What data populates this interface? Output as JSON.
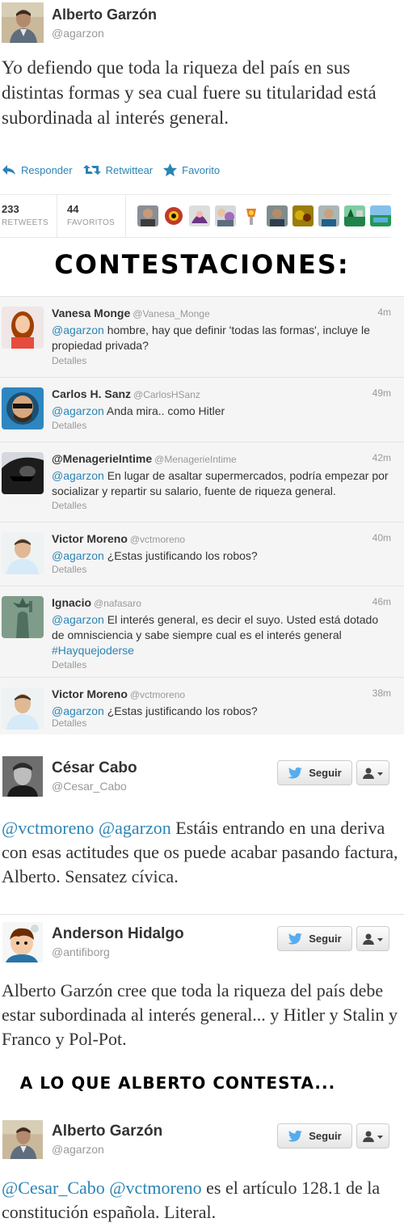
{
  "main_tweet": {
    "name": "Alberto Garzón",
    "handle": "@agarzon",
    "text": "Yo defiendo que toda la riqueza del país en sus distintas formas y sea cual fuere su titularidad está subordinada al interés general.",
    "actions": {
      "reply": "Responder",
      "retweet": "Retwittear",
      "favorite": "Favorito"
    },
    "stats": {
      "retweets_count": "233",
      "retweets_label": "RETWEETS",
      "favorites_count": "44",
      "favorites_label": "FAVORITOS"
    }
  },
  "banner_replies": "CONTESTACIONES:",
  "replies": [
    {
      "name": "Vanesa Monge",
      "handle": "@Vanesa_Monge",
      "time": "4m",
      "mention": "@agarzon",
      "text": " hombre, hay que definir 'todas las formas', incluye le propiedad privada?",
      "hashtag": "",
      "details": "Detalles"
    },
    {
      "name": "Carlos H. Sanz",
      "handle": "@CarlosHSanz",
      "time": "49m",
      "mention": "@agarzon",
      "text": " Anda mira.. como Hitler",
      "hashtag": "",
      "details": "Detalles"
    },
    {
      "name": "@MenagerieIntime",
      "handle": "@MenagerieIntime",
      "time": "42m",
      "mention": "@agarzon",
      "text": " En lugar de asaltar supermercados, podría empezar por socializar y repartir su salario, fuente de riqueza general.",
      "hashtag": "",
      "details": "Detalles"
    },
    {
      "name": "Victor Moreno",
      "handle": "@vctmoreno",
      "time": "40m",
      "mention": "@agarzon",
      "text": " ¿Estas justificando los robos?",
      "hashtag": "",
      "details": "Detalles"
    },
    {
      "name": "Ignacio",
      "handle": "@nafasaro",
      "time": "46m",
      "mention": "@agarzon",
      "text": " El interés general, es decir el suyo. Usted está dotado de omnisciencia y sabe siempre cual es el interés general ",
      "hashtag": "#Hayquejoderse",
      "details": "Detalles"
    },
    {
      "name": "Victor Moreno",
      "handle": "@vctmoreno",
      "time": "38m",
      "mention": "@agarzon",
      "text": " ¿Estas justificando los robos?",
      "hashtag": "",
      "details": "Detalles"
    }
  ],
  "follow_label": "Seguir",
  "big_tweets": [
    {
      "name": "César Cabo",
      "handle": "@Cesar_Cabo",
      "mentions": "@vctmoreno @agarzon",
      "text": " Estáis entrando en una deriva con esas actitudes que os puede acabar pasando factura, Alberto. Sensatez cívica."
    },
    {
      "name": "Anderson Hidalgo",
      "handle": "@antifiborg",
      "mentions": "",
      "text": "Alberto Garzón cree que toda la riqueza del país debe estar subordinada al interés general... y Hitler y Stalin y Franco y Pol-Pot."
    },
    {
      "name": "Alberto Garzón",
      "handle": "@agarzon",
      "mentions": "@Cesar_Cabo @vctmoreno",
      "text": " es el artículo 128.1 de la constitución española. Literal."
    }
  ],
  "banner_answer": "A LO QUE ALBERTO CONTESTA...",
  "colors": {
    "link": "#2a84b5",
    "muted": "#999999",
    "text": "#333333",
    "reply_bg": "#f5f5f5",
    "twitter_blue": "#55acee"
  }
}
